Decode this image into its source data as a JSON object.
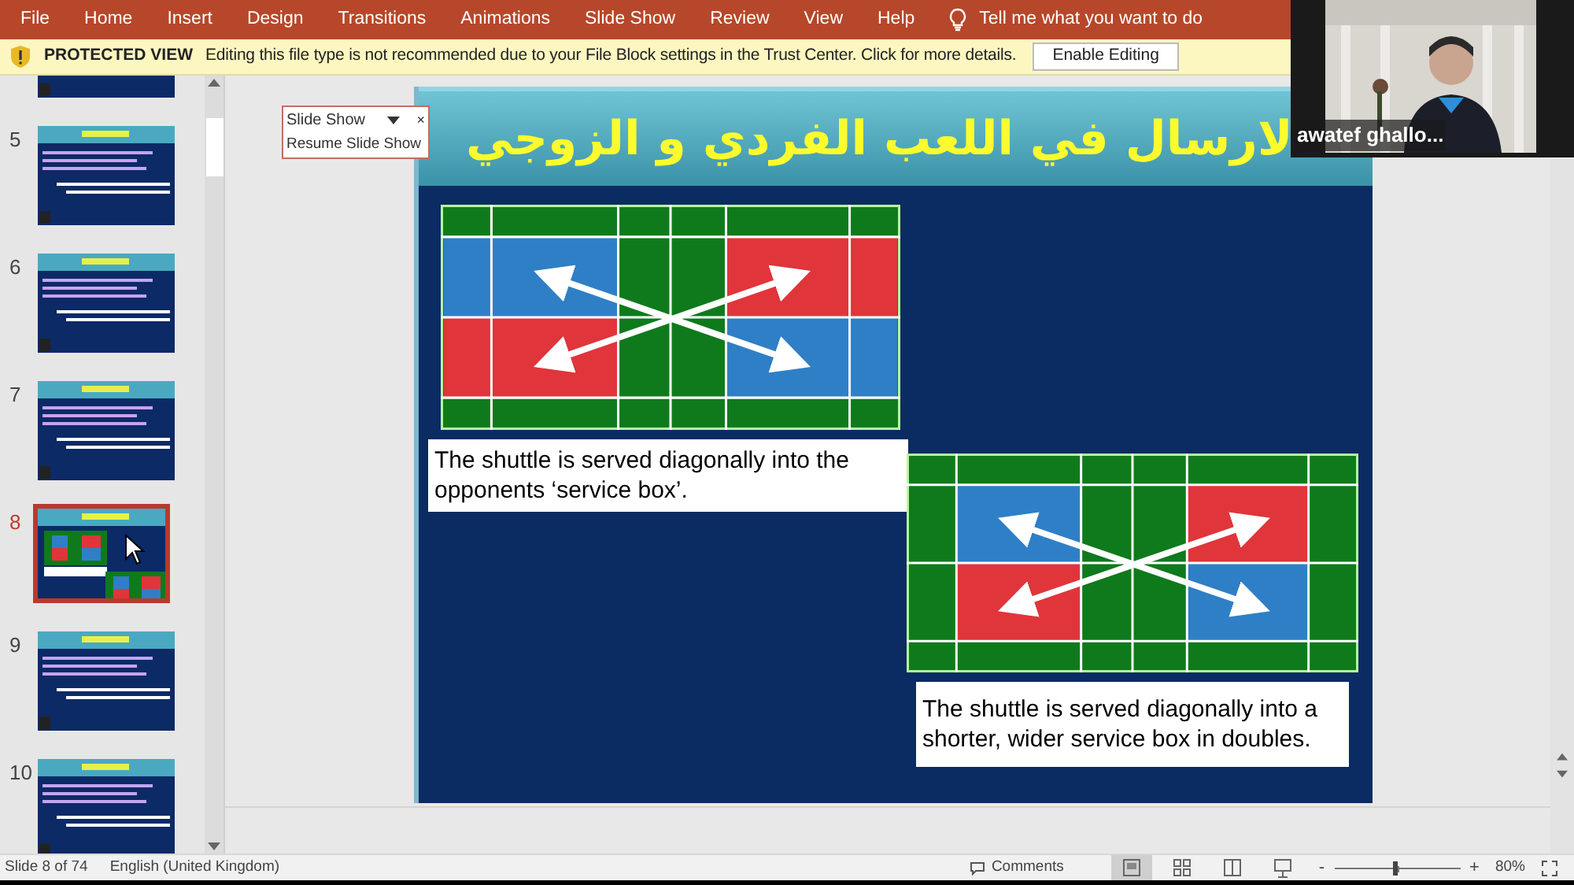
{
  "menu_bar": {
    "tabs": [
      "File",
      "Home",
      "Insert",
      "Design",
      "Transitions",
      "Animations",
      "Slide Show",
      "Review",
      "View",
      "Help"
    ],
    "search_hint": "Tell me what you want to do"
  },
  "protected_view": {
    "label": "PROTECTED VIEW",
    "message": "Editing this file type is not recommended due to your File Block settings in the Trust Center. Click for more details.",
    "button": "Enable Editing"
  },
  "thumbnails": [
    {
      "kind": "cut",
      "selected": false
    },
    {
      "number": "5",
      "kind": "text",
      "selected": false
    },
    {
      "number": "6",
      "kind": "text",
      "selected": false
    },
    {
      "number": "7",
      "kind": "text",
      "selected": false
    },
    {
      "number": "8",
      "kind": "courts",
      "selected": true
    },
    {
      "number": "9",
      "kind": "text",
      "selected": false
    },
    {
      "number": "10",
      "kind": "text",
      "selected": false
    }
  ],
  "slide_show_popup": {
    "title": "Slide Show",
    "close": "×",
    "link": "Resume Slide Show"
  },
  "slide": {
    "title": "لارسال  في اللعب الفردي و الزوجي",
    "captions": [
      "The shuttle is served diagonally into the opponents ‘service box’.",
      "The shuttle is served diagonally into a shorter, wider service box in doubles."
    ]
  },
  "video_tile": {
    "name": "awatef ghallo..."
  },
  "status_bar": {
    "slide": "Slide 8 of 74",
    "language": "English (United Kingdom)",
    "comments": "Comments",
    "views": [
      {
        "kind": "normal",
        "selected": true
      },
      {
        "kind": "sorter",
        "selected": false
      },
      {
        "kind": "reading",
        "selected": false
      },
      {
        "kind": "slideshow",
        "selected": false
      }
    ],
    "zoom": {
      "minus": "-",
      "plus": "+",
      "level": 0.48,
      "percent": "80%"
    }
  }
}
